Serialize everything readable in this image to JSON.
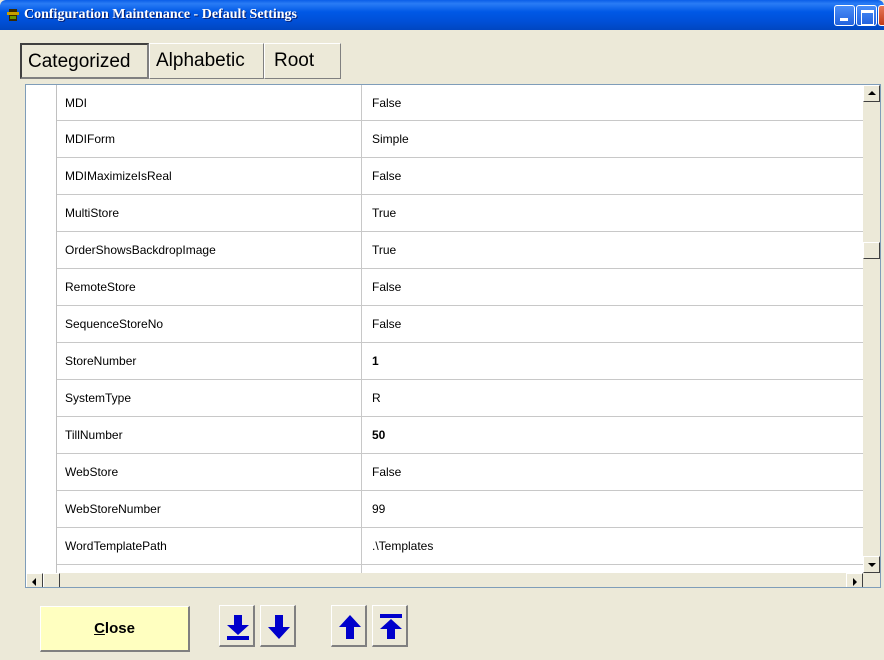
{
  "window": {
    "title": "Configuration Maintenance - Default Settings"
  },
  "tabs": [
    {
      "label": "Categorized",
      "active": true
    },
    {
      "label": "Alphabetic",
      "active": false
    },
    {
      "label": "Root",
      "active": false
    }
  ],
  "grid": {
    "rows": [
      {
        "name": "MDI",
        "value": "False",
        "bold": false
      },
      {
        "name": "MDIForm",
        "value": "Simple",
        "bold": false
      },
      {
        "name": "MDIMaximizeIsReal",
        "value": "False",
        "bold": false
      },
      {
        "name": "MultiStore",
        "value": "True",
        "bold": false
      },
      {
        "name": "OrderShowsBackdropImage",
        "value": "True",
        "bold": false
      },
      {
        "name": "RemoteStore",
        "value": "False",
        "bold": false
      },
      {
        "name": "SequenceStoreNo",
        "value": "False",
        "bold": false
      },
      {
        "name": "StoreNumber",
        "value": "1",
        "bold": true
      },
      {
        "name": "SystemType",
        "value": "R",
        "bold": false
      },
      {
        "name": "TillNumber",
        "value": "50",
        "bold": true
      },
      {
        "name": "WebStore",
        "value": "False",
        "bold": false
      },
      {
        "name": "WebStoreNumber",
        "value": "99",
        "bold": false
      },
      {
        "name": "WordTemplatePath",
        "value": ".\\Templates",
        "bold": false
      }
    ]
  },
  "footer": {
    "close_label": "Close",
    "close_accel": "C",
    "close_rest": "lose",
    "nav_buttons": [
      {
        "icon": "move-to-first-down-icon"
      },
      {
        "icon": "arrow-down-icon"
      },
      {
        "icon": "arrow-up-icon"
      },
      {
        "icon": "move-to-top-icon"
      }
    ]
  },
  "colors": {
    "titlebar": "#0058e6",
    "close_button_bg": "#ffffc0",
    "nav_arrow": "#0000cc"
  }
}
